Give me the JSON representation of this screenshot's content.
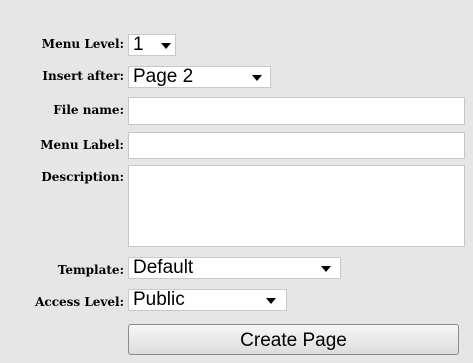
{
  "form": {
    "menu_level": {
      "label": "Menu Level:",
      "value": "1"
    },
    "insert_after": {
      "label": "Insert after:",
      "value": "Page 2"
    },
    "file_name": {
      "label": "File name:",
      "value": ""
    },
    "menu_label": {
      "label": "Menu Label:",
      "value": ""
    },
    "description": {
      "label": "Description:",
      "value": ""
    },
    "template": {
      "label": "Template:",
      "value": "Default"
    },
    "access_level": {
      "label": "Access Level:",
      "value": "Public"
    },
    "submit_label": "Create Page"
  },
  "icons": {
    "dropdown_arrow": "chevron-down-icon"
  }
}
